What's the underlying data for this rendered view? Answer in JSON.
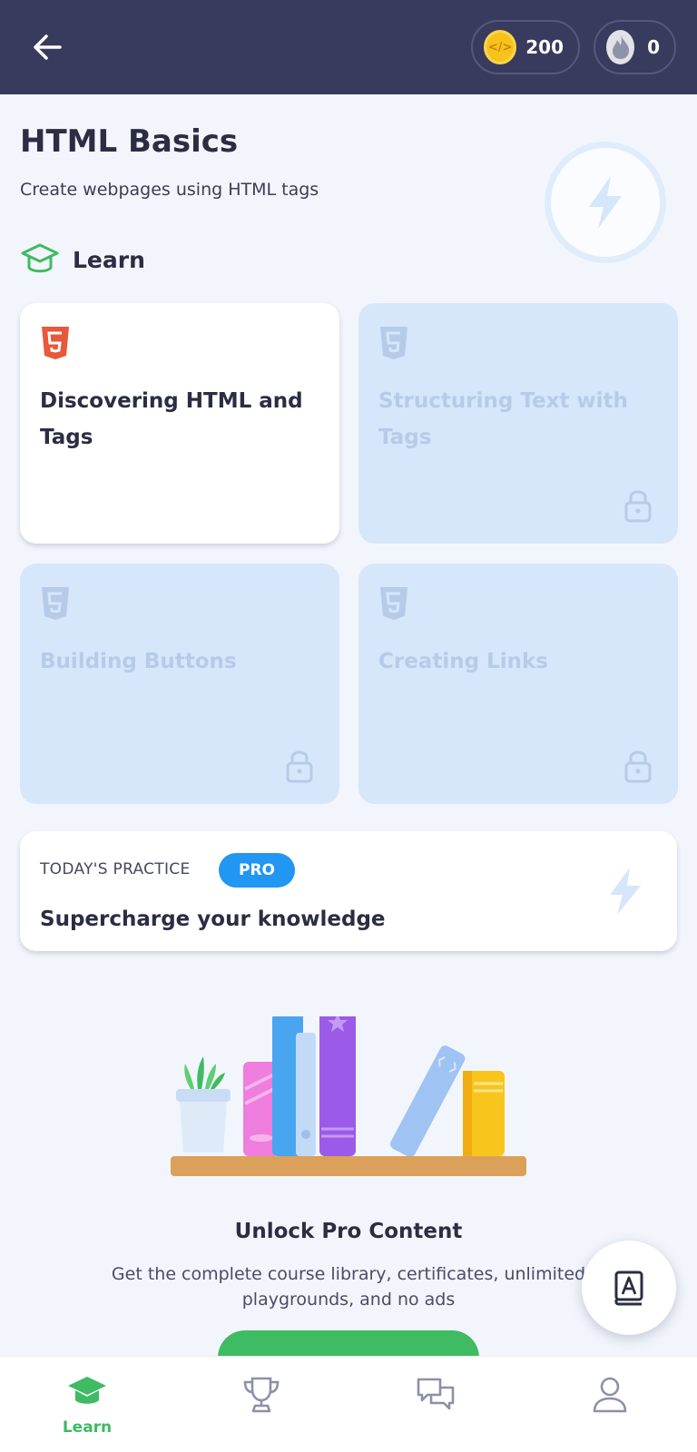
{
  "header": {
    "back_icon": "arrow-left-icon",
    "coins": "200",
    "streak": "0",
    "colors": {
      "bar": "#383a5e",
      "coin": "#f7c21c"
    }
  },
  "course": {
    "title": "HTML Basics",
    "subtitle": "Create webpages using HTML tags",
    "section_label": "Learn"
  },
  "lessons": [
    {
      "title": "Discovering HTML and Tags",
      "locked": false,
      "icon": "html5-icon"
    },
    {
      "title": "Structuring Text with Tags",
      "locked": true,
      "icon": "html5-icon"
    },
    {
      "title": "Building Buttons",
      "locked": true,
      "icon": "html5-icon"
    },
    {
      "title": "Creating Links",
      "locked": true,
      "icon": "html5-icon"
    }
  ],
  "practice": {
    "kicker": "TODAY'S PRACTICE",
    "badge": "PRO",
    "headline": "Supercharge your knowledge"
  },
  "promo": {
    "title": "Unlock Pro Content",
    "description": "Get the complete course library, certificates, unlimited playgrounds, and no ads"
  },
  "nav": {
    "items": [
      {
        "label": "Learn",
        "icon": "graduation-cap-icon",
        "active": true
      },
      {
        "label": "",
        "icon": "trophy-icon",
        "active": false
      },
      {
        "label": "",
        "icon": "chat-bubbles-icon",
        "active": false
      },
      {
        "label": "",
        "icon": "profile-icon",
        "active": false
      }
    ]
  },
  "accent": {
    "green": "#3fbb63",
    "blue": "#2196f3",
    "html5": "#e8583a"
  }
}
